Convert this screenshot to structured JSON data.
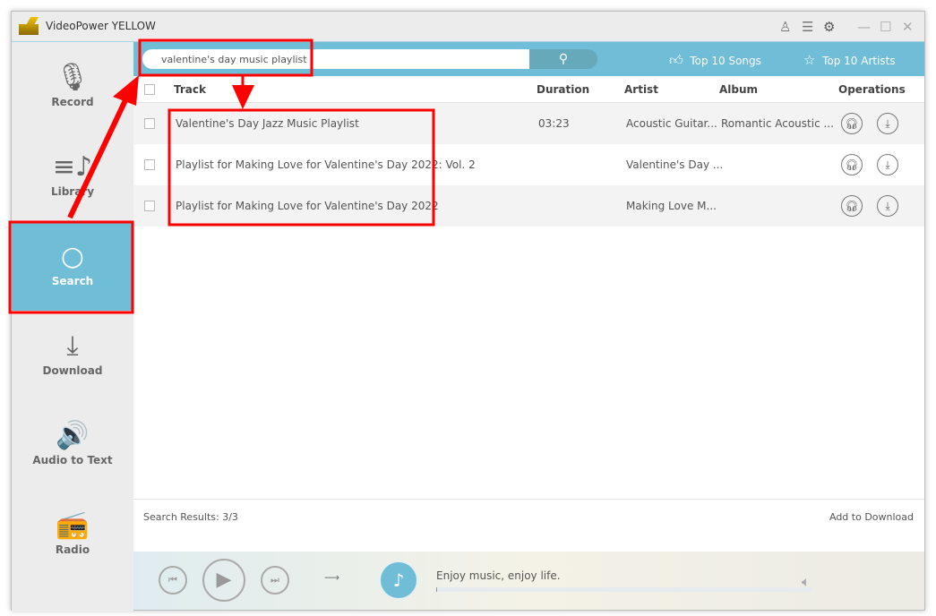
{
  "app": {
    "title": "VideoPower YELLOW"
  },
  "titlebar": {
    "icons": [
      "user-icon",
      "list-icon",
      "gear-icon",
      "minimize-icon",
      "maximize-icon",
      "close-icon"
    ]
  },
  "sidebar": {
    "items": [
      {
        "label": "Record",
        "icon": "microphone-icon"
      },
      {
        "label": "Library",
        "icon": "music-list-icon"
      },
      {
        "label": "Search",
        "icon": "search-icon",
        "active": true
      },
      {
        "label": "Download",
        "icon": "download-icon"
      },
      {
        "label": "Audio to Text",
        "icon": "speaker-icon"
      },
      {
        "label": "Radio",
        "icon": "radio-icon"
      }
    ]
  },
  "search": {
    "value": "valentine's day music playlist",
    "top_songs": "Top 10 Songs",
    "top_artists": "Top 10 Artists"
  },
  "table": {
    "headers": {
      "track": "Track",
      "duration": "Duration",
      "artist": "Artist",
      "album": "Album",
      "operations": "Operations"
    },
    "rows": [
      {
        "track": "Valentine's Day Jazz Music Playlist",
        "duration": "03:23",
        "artist": "Acoustic Guitar...",
        "album": "Romantic Acoustic ..."
      },
      {
        "track": "Playlist for Making Love for Valentine's Day 2022: Vol. 2",
        "duration": "",
        "artist": "Valentine's Day ...",
        "album": ""
      },
      {
        "track": "Playlist for Making Love for Valentine's Day 2022",
        "duration": "",
        "artist": "Making Love M...",
        "album": ""
      }
    ]
  },
  "footer": {
    "results": "Search Results: 3/3",
    "add": "Add to Download"
  },
  "player": {
    "tagline": "Enjoy music, enjoy life.",
    "progress": 0
  },
  "colors": {
    "accent": "#6fbdd6",
    "annotation": "#ff0000"
  }
}
